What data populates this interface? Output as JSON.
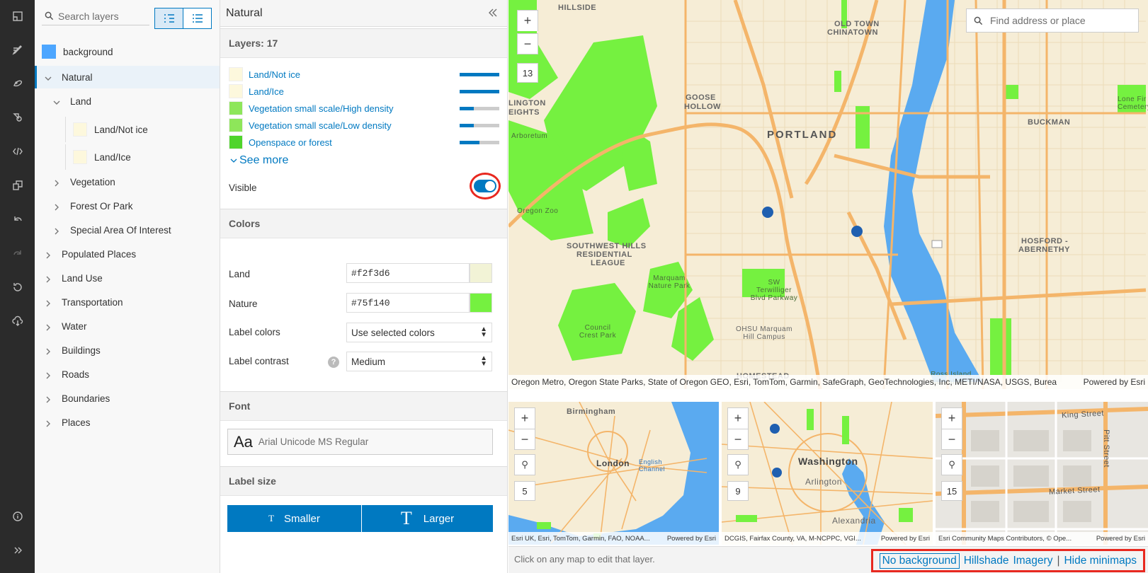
{
  "rail": {
    "icons": [
      "basemap-icon",
      "edit-icon",
      "style-icon",
      "shapes-icon",
      "code-icon",
      "copy-icon",
      "undo-icon",
      "redo-icon",
      "reset-icon",
      "download-icon",
      "info-icon",
      "expand-icon"
    ]
  },
  "tree": {
    "search_placeholder": "Search layers",
    "items": [
      {
        "label": "background",
        "level": 0,
        "type": "swatch",
        "color": "#4da6ff"
      },
      {
        "label": "Natural",
        "level": 0,
        "type": "expanded",
        "selected": true
      },
      {
        "label": "Land",
        "level": 1,
        "type": "expanded"
      },
      {
        "label": "Land/Not ice",
        "level": 2,
        "type": "swatch",
        "color": "#fdf8dd"
      },
      {
        "label": "Land/Ice",
        "level": 2,
        "type": "swatch",
        "color": "#fdf8dd"
      },
      {
        "label": "Vegetation",
        "level": 1,
        "type": "collapsed"
      },
      {
        "label": "Forest Or Park",
        "level": 1,
        "type": "collapsed"
      },
      {
        "label": "Special Area Of Interest",
        "level": 1,
        "type": "collapsed"
      },
      {
        "label": "Populated Places",
        "level": 0,
        "type": "collapsed"
      },
      {
        "label": "Land Use",
        "level": 0,
        "type": "collapsed"
      },
      {
        "label": "Transportation",
        "level": 0,
        "type": "collapsed"
      },
      {
        "label": "Water",
        "level": 0,
        "type": "collapsed"
      },
      {
        "label": "Buildings",
        "level": 0,
        "type": "collapsed"
      },
      {
        "label": "Roads",
        "level": 0,
        "type": "collapsed"
      },
      {
        "label": "Boundaries",
        "level": 0,
        "type": "collapsed"
      },
      {
        "label": "Places",
        "level": 0,
        "type": "collapsed"
      }
    ]
  },
  "props": {
    "title": "Natural",
    "layers_heading": "Layers: 17",
    "layers": [
      {
        "label": "Land/Not ice",
        "color": "#fdf8dd",
        "level": 1.0
      },
      {
        "label": "Land/Ice",
        "color": "#fdf8dd",
        "level": 1.0
      },
      {
        "label": "Vegetation small scale/High density",
        "color": "#8ee65a",
        "level": 0.35
      },
      {
        "label": "Vegetation small scale/Low density",
        "color": "#8ee65a",
        "level": 0.35
      },
      {
        "label": "Openspace or forest",
        "color": "#4fd42b",
        "level": 0.5
      }
    ],
    "see_more": "See more",
    "visible_label": "Visible",
    "visible_on": true,
    "colors_heading": "Colors",
    "land_label": "Land",
    "land_value": "#f2f3d6",
    "nature_label": "Nature",
    "nature_value": "#75f140",
    "label_colors_label": "Label colors",
    "label_colors_value": "Use selected colors",
    "label_contrast_label": "Label contrast",
    "label_contrast_value": "Medium",
    "font_heading": "Font",
    "font_sample": "Aa",
    "font_name": "Arial Unicode MS Regular",
    "label_size_heading": "Label size",
    "smaller_label": "Smaller",
    "larger_label": "Larger",
    "smaller_glyph": "T",
    "larger_glyph": "T"
  },
  "map": {
    "search_placeholder": "Find address or place",
    "zoom": "13",
    "attribution": "Oregon Metro, Oregon State Parks, State of Oregon GEO, Esri, TomTom, Garmin, SafeGraph, GeoTechnologies, Inc, METI/NASA, USGS, Bureau ...",
    "powered": "Powered by Esri",
    "labels": {
      "hillside": "HILLSIDE",
      "old_town": "OLD TOWN",
      "chinatown": "CHINATOWN",
      "goose_hollow_1": "GOOSE",
      "goose_hollow_2": "HOLLOW",
      "portland": "PORTLAND",
      "buckman": "BUCKMAN",
      "sw_hills_1": "SOUTHWEST HILLS",
      "sw_hills_2": "RESIDENTIAL",
      "sw_hills_3": "LEAGUE",
      "hosford_1": "HOSFORD -",
      "hosford_2": "ABERNETHY",
      "homestead": "HOMESTEAD",
      "lington": "LINGTON",
      "eights": "EIGHTS",
      "oregon_zoo": "Oregon Zoo",
      "arboretum": "Arboretum",
      "marquam": "Marquam Nature Park",
      "council_crest": "Council Crest Park",
      "ohsu": "OHSU Marquam Hill Campus",
      "terwilliger": "SW Terwilliger Blvd Parkway",
      "ross_island": "Ross Island Natural Area",
      "lone_fir": "Lone Fir Cemetery"
    }
  },
  "minimaps": [
    {
      "zoom": "5",
      "attribution": "Esri UK, Esri, TomTom, Garmin, FAO, NOAA...",
      "powered": "Powered by Esri",
      "city": "London",
      "labels": [
        "Birmingham",
        "English Channel"
      ]
    },
    {
      "zoom": "9",
      "attribution": "DCGIS, Fairfax County, VA, M-NCPPC, VGI...",
      "powered": "Powered by Esri",
      "city": "Washington",
      "labels": [
        "Arlington",
        "Alexandria"
      ]
    },
    {
      "zoom": "15",
      "attribution": "Esri Community Maps Contributors, © Ope...",
      "powered": "Powered by Esri",
      "city": "",
      "labels": [
        "King Street",
        "Market Street",
        "Pitt Street"
      ]
    }
  ],
  "footer": {
    "hint": "Click on any map to edit that layer.",
    "no_background": "No background",
    "hillshade": "Hillshade",
    "imagery": "Imagery",
    "hide_minimaps": "Hide minimaps",
    "separator": "|"
  },
  "colors": {
    "accent": "#0079c1",
    "highlight": "#e8281f",
    "nature": "#75f140",
    "land": "#f6edd6",
    "water": "#5aaaf0",
    "road": "#f4b56a"
  }
}
